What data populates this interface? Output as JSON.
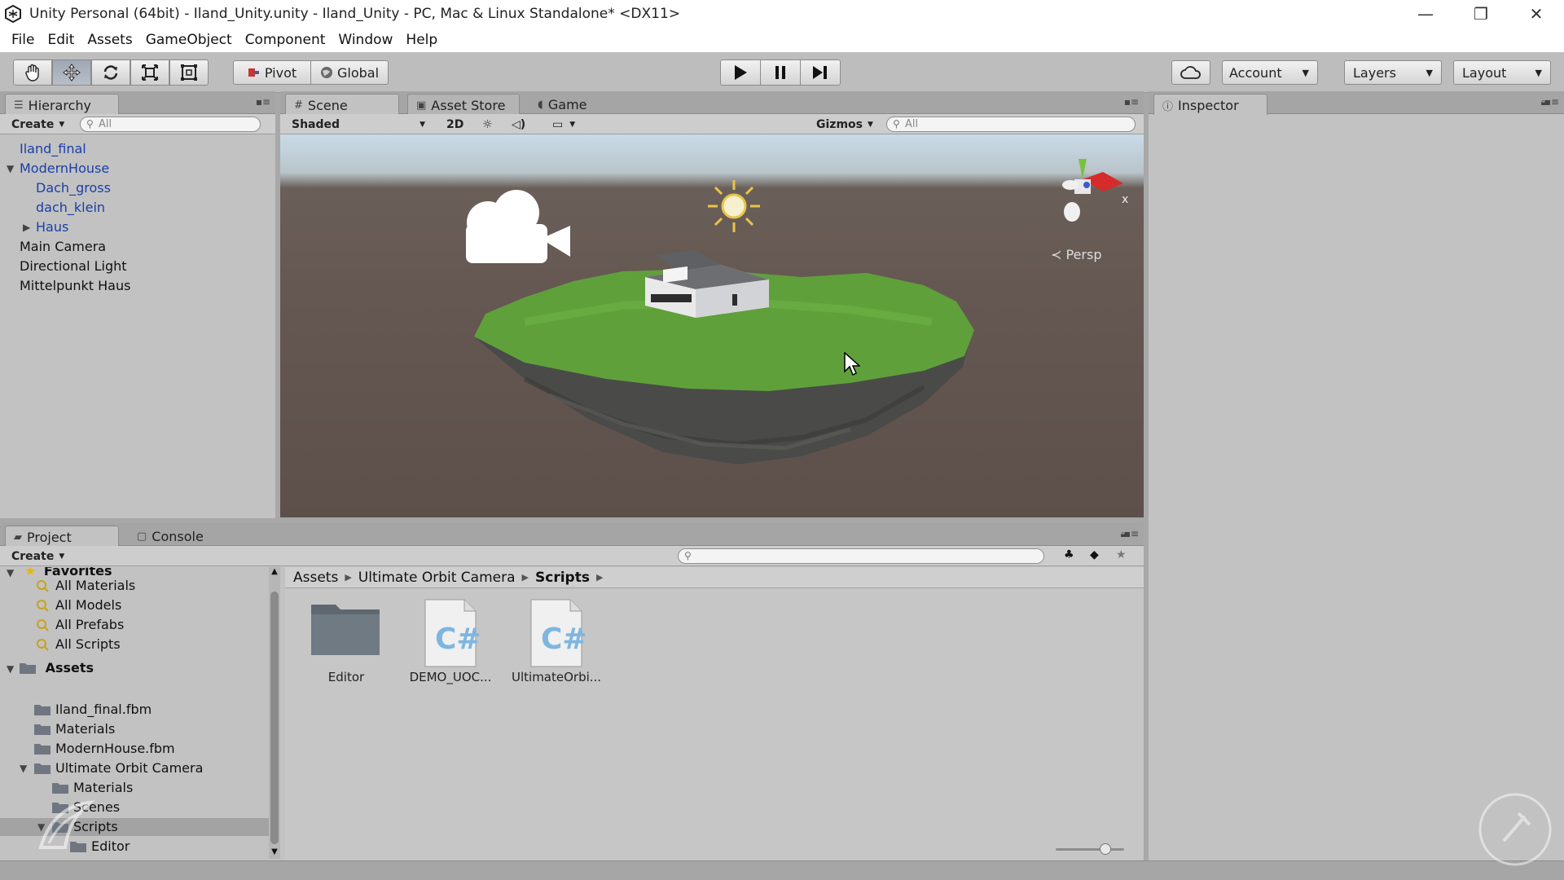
{
  "window": {
    "title": "Unity Personal (64bit) - Iland_Unity.unity - Iland_Unity - PC, Mac & Linux Standalone* <DX11>",
    "controls": [
      "—",
      "❐",
      "✕"
    ]
  },
  "menu": [
    "File",
    "Edit",
    "Assets",
    "GameObject",
    "Component",
    "Window",
    "Help"
  ],
  "toolbar": {
    "pivot_label": "Pivot",
    "global_label": "Global",
    "account_label": "Account",
    "layers_label": "Layers",
    "layout_label": "Layout"
  },
  "hierarchy": {
    "tab_label": "Hierarchy",
    "create_label": "Create",
    "search_placeholder": "All",
    "items": [
      {
        "label": "Iland_final",
        "depth": 0,
        "arrow": "",
        "color": "blue"
      },
      {
        "label": "ModernHouse",
        "depth": 0,
        "arrow": "expanded",
        "color": "blue"
      },
      {
        "label": "Dach_gross",
        "depth": 1,
        "arrow": "",
        "color": "blue"
      },
      {
        "label": "dach_klein",
        "depth": 1,
        "arrow": "",
        "color": "blue"
      },
      {
        "label": "Haus",
        "depth": 1,
        "arrow": "collapsed",
        "color": "blue"
      },
      {
        "label": "Main Camera",
        "depth": 0,
        "arrow": "",
        "color": "black"
      },
      {
        "label": "Directional Light",
        "depth": 0,
        "arrow": "",
        "color": "black"
      },
      {
        "label": "Mittelpunkt Haus",
        "depth": 0,
        "arrow": "",
        "color": "black"
      }
    ]
  },
  "scene": {
    "tabs": [
      "Scene",
      "Asset Store",
      "Game"
    ],
    "shading_mode": "Shaded",
    "mode_2d": "2D",
    "gizmos_label": "Gizmos",
    "search_placeholder": "All",
    "projection_label": "Persp",
    "gizmo_axis_label": "x"
  },
  "inspector": {
    "tab_label": "Inspector"
  },
  "project": {
    "tabs": [
      "Project",
      "Console"
    ],
    "create_label": "Create",
    "favorites_title": "Favorites",
    "favorites": [
      "All Materials",
      "All Models",
      "All Prefabs",
      "All Scripts"
    ],
    "assets_title": "Assets",
    "asset_tree": [
      {
        "label": "Iland_final.fbm",
        "depth": 1
      },
      {
        "label": "Materials",
        "depth": 1
      },
      {
        "label": "ModernHouse.fbm",
        "depth": 1
      },
      {
        "label": "Ultimate Orbit Camera",
        "depth": 1
      },
      {
        "label": "Materials",
        "depth": 2
      },
      {
        "label": "Scenes",
        "depth": 2
      },
      {
        "label": "Scripts",
        "depth": 2
      },
      {
        "label": "Editor",
        "depth": 3
      }
    ],
    "breadcrumb": [
      "Assets",
      "Ultimate Orbit Camera",
      "Scripts"
    ],
    "files": [
      {
        "name": "Editor",
        "kind": "folder"
      },
      {
        "name": "DEMO_UOC...",
        "kind": "csharp"
      },
      {
        "name": "UltimateOrbi...",
        "kind": "csharp"
      }
    ],
    "script_glyph": "C#"
  },
  "colors": {
    "accent_blue": "#1a3fa8",
    "panel_bg": "#c2c2c2",
    "selection": "#a9a9a9"
  }
}
